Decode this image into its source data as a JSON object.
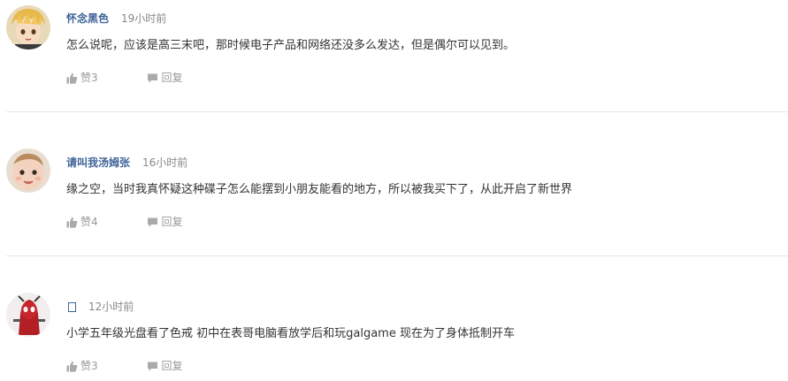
{
  "comments": [
    {
      "username": "怀念黑色",
      "time": "19小时前",
      "text": "怎么说呢，应该是高三末吧，那时候电子产品和网络还没多么发达，但是偶尔可以见到。",
      "like_label": "赞3",
      "reply_label": "回复",
      "avatar_icon": "anime-boy-avatar"
    },
    {
      "username": "请叫我汤姆张",
      "time": "16小时前",
      "text": "缘之空，当时我真怀疑这种碟子怎么能摆到小朋友能看的地方，所以被我买下了，从此开启了新世界",
      "like_label": "赞4",
      "reply_label": "回复",
      "avatar_icon": "baby-avatar"
    },
    {
      "username": "",
      "time": "12小时前",
      "text": "小学五年级光盘看了色戒 初中在表哥电脑看放学后和玩galgame 现在为了身体抵制开车",
      "like_label": "赞3",
      "reply_label": "回复",
      "avatar_icon": "red-character-avatar"
    }
  ],
  "colors": {
    "username": "#406599",
    "meta": "#888888",
    "text": "#333333",
    "action": "#999999"
  }
}
